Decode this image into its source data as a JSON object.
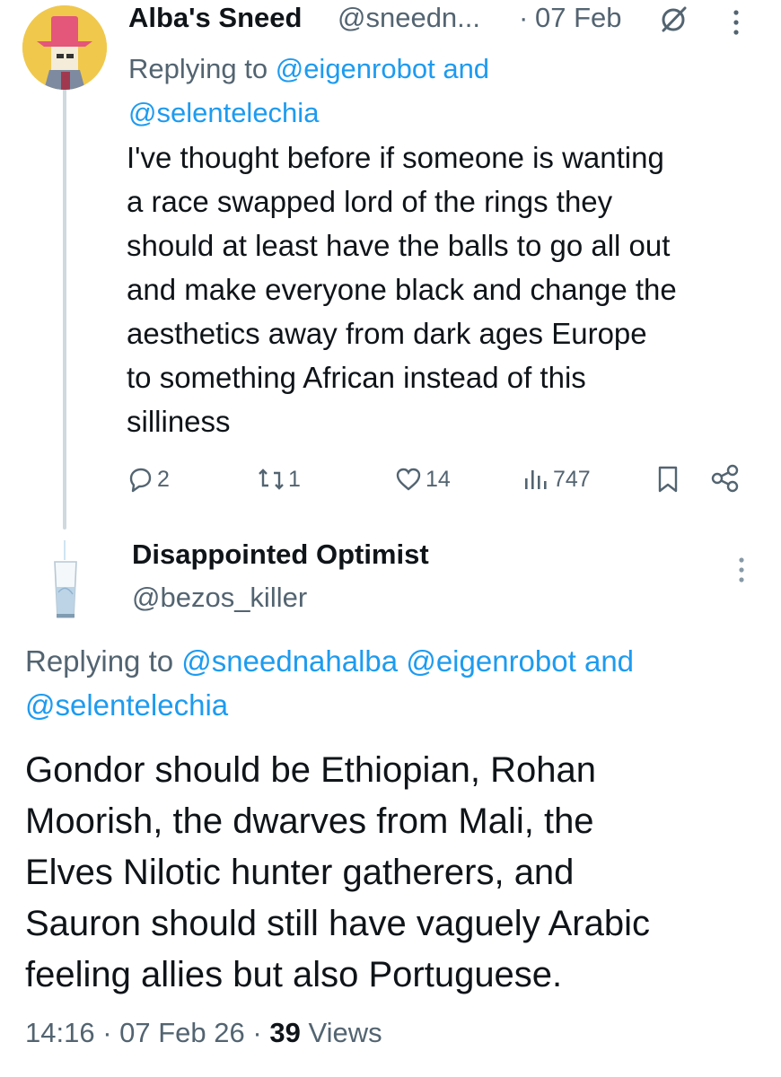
{
  "tweet1": {
    "display_name": "Alba's Sneed",
    "handle": "@sneedn...",
    "separator": "·",
    "date": "07 Feb",
    "replying_prefix": "Replying to",
    "replying_user1": "@eigenrobot",
    "replying_and": "and",
    "replying_user2": "@selentelechia",
    "body": "I've thought before if someone is wanting\na race swapped lord of the rings they\nshould at least have the balls to go all out\nand make everyone black and change the\naesthetics away from dark ages Europe\nto something African instead of this\nsilliness",
    "replies": "2",
    "reposts": "1",
    "likes": "14",
    "views": "747",
    "icons": {
      "grok": "grok-icon",
      "more": "more-vertical-icon",
      "reply": "reply-icon",
      "repost": "repost-icon",
      "like": "heart-icon",
      "views": "views-icon",
      "bookmark": "bookmark-icon",
      "share": "share-icon"
    }
  },
  "tweet2": {
    "display_name": "Disappointed Optimist",
    "handle": "@bezos_killer",
    "replying_prefix": "Replying to",
    "replying_user1": "@sneednahalba",
    "replying_user2": "@eigenrobot",
    "replying_and": "and",
    "replying_user3": "@selentelechia",
    "body": "Gondor should be Ethiopian, Rohan\nMoorish, the dwarves from Mali, the\nElves Nilotic hunter gatherers, and\nSauron should still have vaguely Arabic\nfeeling allies but also Portuguese.",
    "time": "14:16",
    "sep1": "·",
    "date": "07 Feb 26",
    "sep2": "·",
    "views_count": "39",
    "views_label": "Views"
  },
  "colors": {
    "accent": "#1d9bf0",
    "text": "#0f1419",
    "secondary": "#536471",
    "thread_line": "#cfd9de"
  }
}
